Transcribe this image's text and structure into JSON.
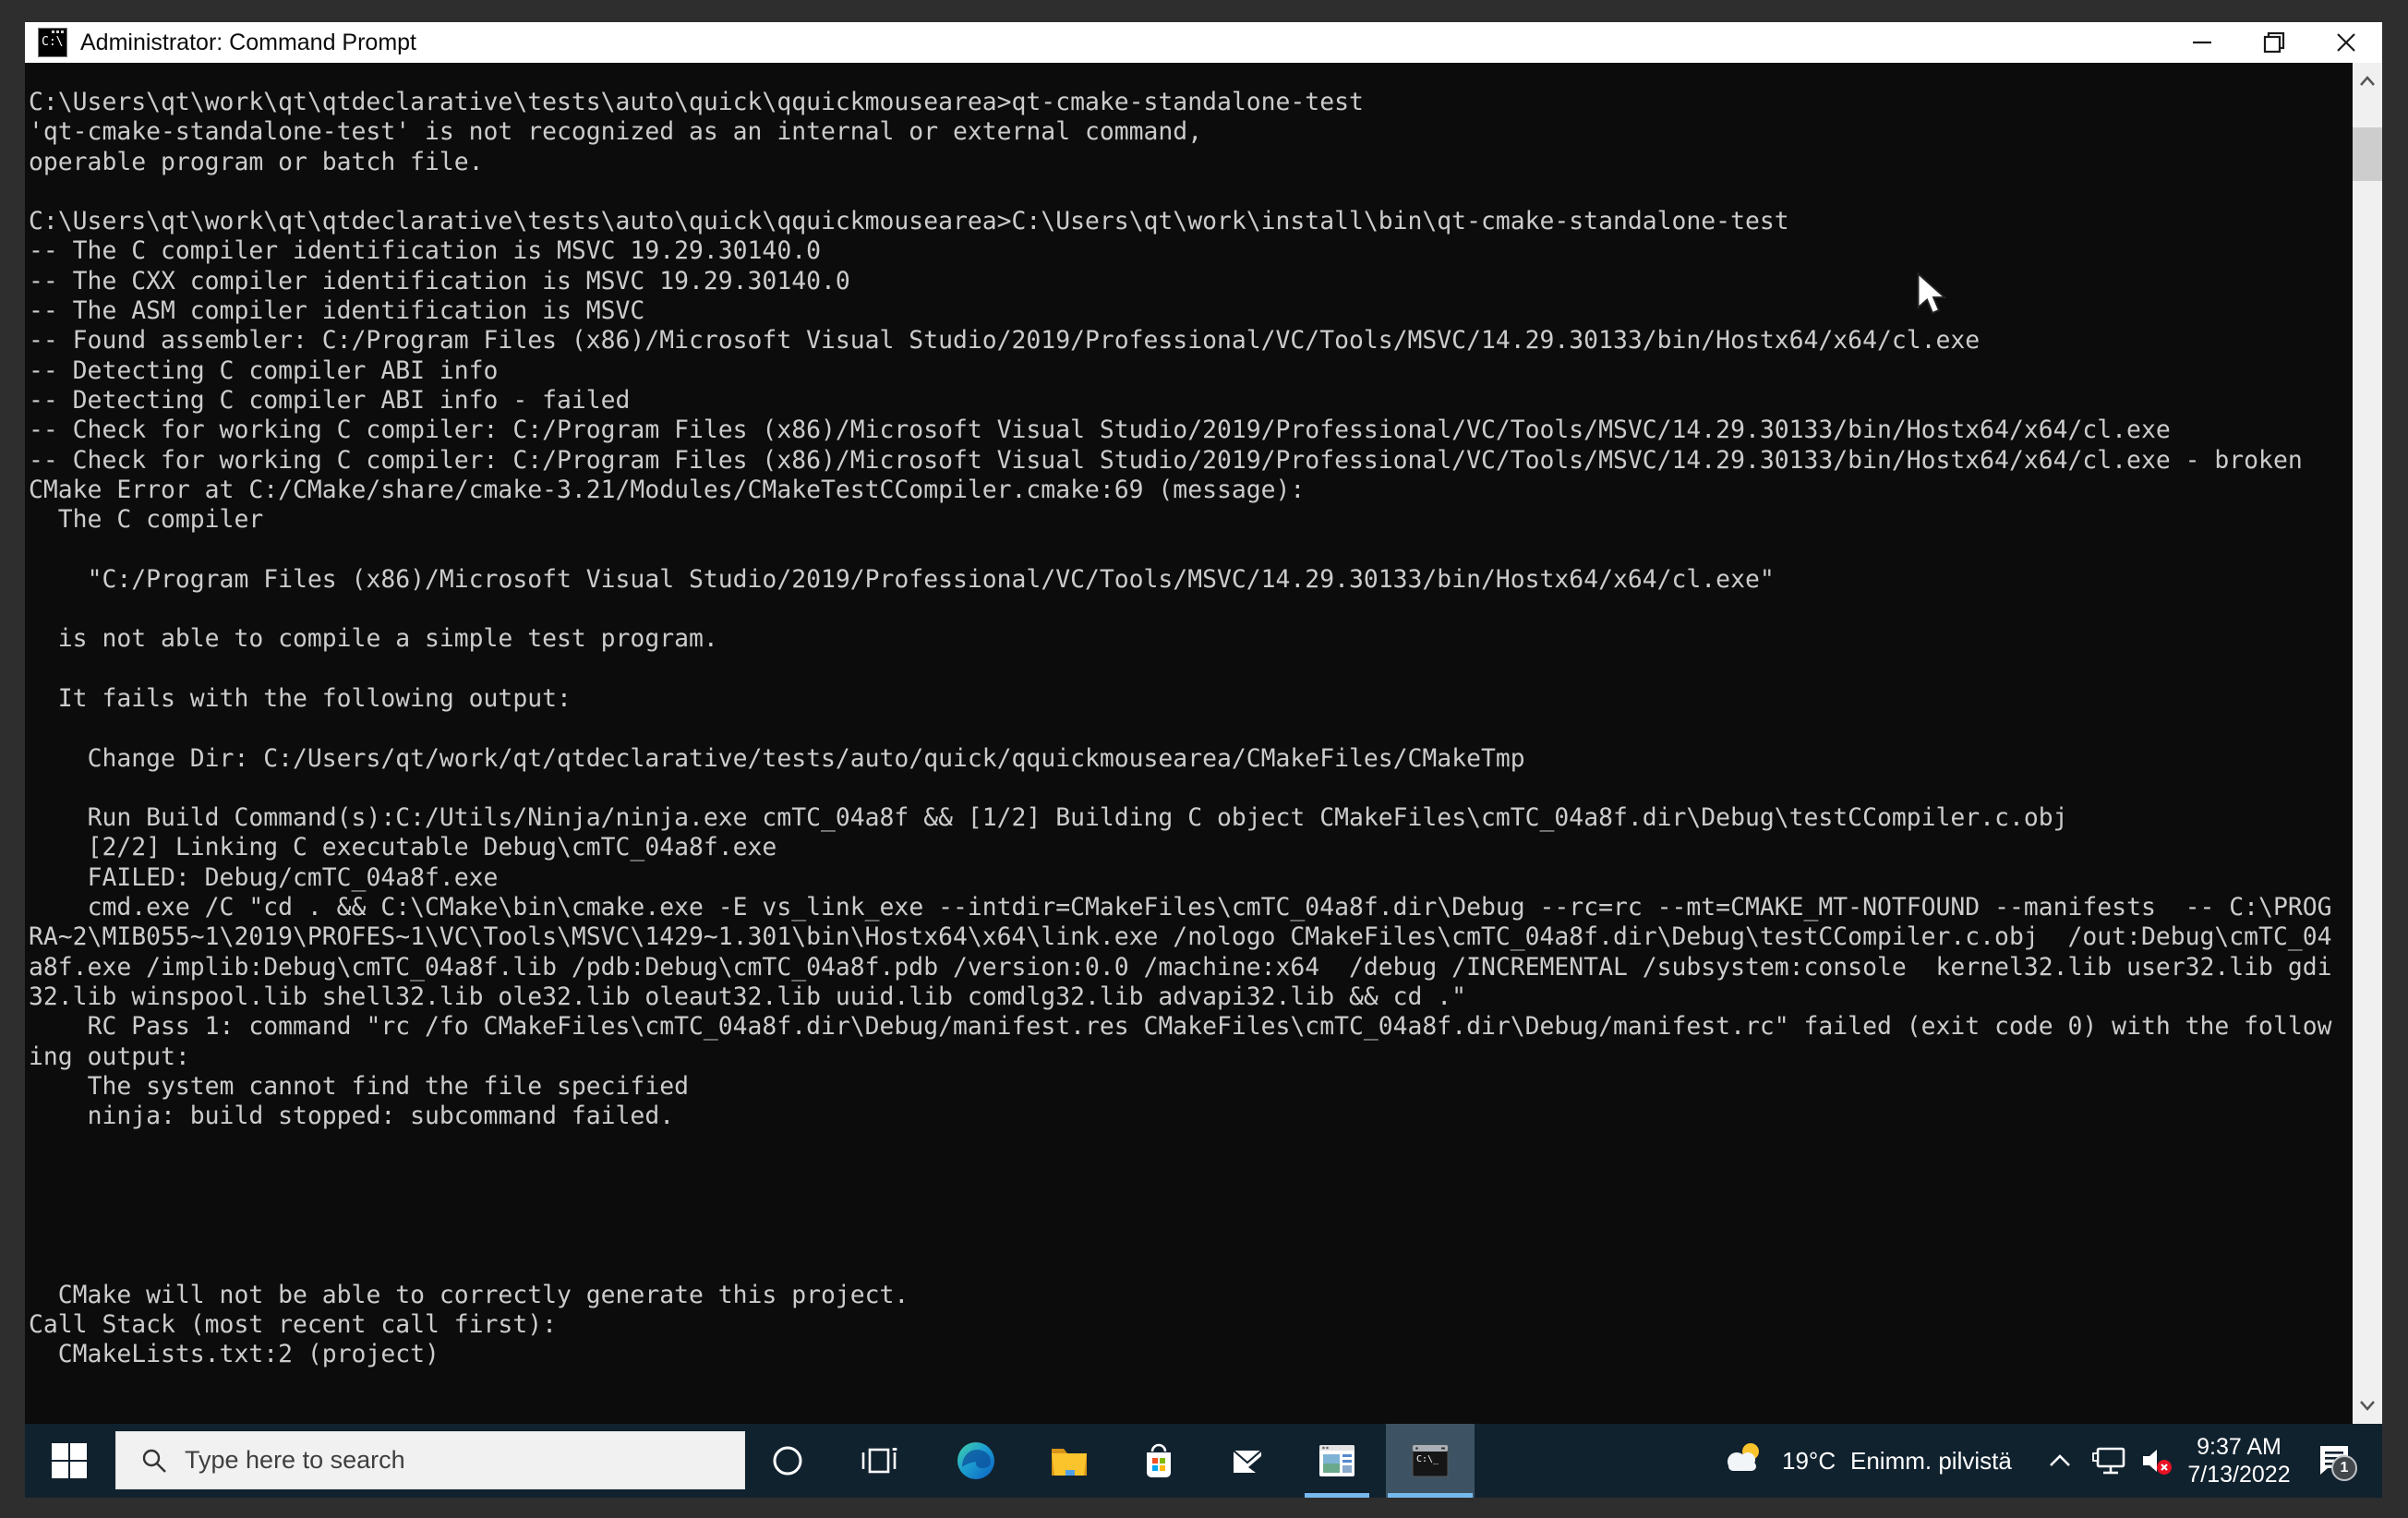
{
  "window": {
    "title": "Administrator: Command Prompt"
  },
  "console": {
    "lines": [
      "C:\\Users\\qt\\work\\qt\\qtdeclarative\\tests\\auto\\quick\\qquickmousearea>qt-cmake-standalone-test",
      "'qt-cmake-standalone-test' is not recognized as an internal or external command,",
      "operable program or batch file.",
      "",
      "C:\\Users\\qt\\work\\qt\\qtdeclarative\\tests\\auto\\quick\\qquickmousearea>C:\\Users\\qt\\work\\install\\bin\\qt-cmake-standalone-test",
      "-- The C compiler identification is MSVC 19.29.30140.0",
      "-- The CXX compiler identification is MSVC 19.29.30140.0",
      "-- The ASM compiler identification is MSVC",
      "-- Found assembler: C:/Program Files (x86)/Microsoft Visual Studio/2019/Professional/VC/Tools/MSVC/14.29.30133/bin/Hostx64/x64/cl.exe",
      "-- Detecting C compiler ABI info",
      "-- Detecting C compiler ABI info - failed",
      "-- Check for working C compiler: C:/Program Files (x86)/Microsoft Visual Studio/2019/Professional/VC/Tools/MSVC/14.29.30133/bin/Hostx64/x64/cl.exe",
      "-- Check for working C compiler: C:/Program Files (x86)/Microsoft Visual Studio/2019/Professional/VC/Tools/MSVC/14.29.30133/bin/Hostx64/x64/cl.exe - broken",
      "CMake Error at C:/CMake/share/cmake-3.21/Modules/CMakeTestCCompiler.cmake:69 (message):",
      "  The C compiler",
      "",
      "    \"C:/Program Files (x86)/Microsoft Visual Studio/2019/Professional/VC/Tools/MSVC/14.29.30133/bin/Hostx64/x64/cl.exe\"",
      "",
      "  is not able to compile a simple test program.",
      "",
      "  It fails with the following output:",
      "",
      "    Change Dir: C:/Users/qt/work/qt/qtdeclarative/tests/auto/quick/qquickmousearea/CMakeFiles/CMakeTmp",
      "",
      "    Run Build Command(s):C:/Utils/Ninja/ninja.exe cmTC_04a8f && [1/2] Building C object CMakeFiles\\cmTC_04a8f.dir\\Debug\\testCCompiler.c.obj",
      "    [2/2] Linking C executable Debug\\cmTC_04a8f.exe",
      "    FAILED: Debug/cmTC_04a8f.exe",
      "    cmd.exe /C \"cd . && C:\\CMake\\bin\\cmake.exe -E vs_link_exe --intdir=CMakeFiles\\cmTC_04a8f.dir\\Debug --rc=rc --mt=CMAKE_MT-NOTFOUND --manifests  -- C:\\PROG",
      "RA~2\\MIB055~1\\2019\\PROFES~1\\VC\\Tools\\MSVC\\1429~1.301\\bin\\Hostx64\\x64\\link.exe /nologo CMakeFiles\\cmTC_04a8f.dir\\Debug\\testCCompiler.c.obj  /out:Debug\\cmTC_04",
      "a8f.exe /implib:Debug\\cmTC_04a8f.lib /pdb:Debug\\cmTC_04a8f.pdb /version:0.0 /machine:x64  /debug /INCREMENTAL /subsystem:console  kernel32.lib user32.lib gdi",
      "32.lib winspool.lib shell32.lib ole32.lib oleaut32.lib uuid.lib comdlg32.lib advapi32.lib && cd .\"",
      "    RC Pass 1: command \"rc /fo CMakeFiles\\cmTC_04a8f.dir\\Debug/manifest.res CMakeFiles\\cmTC_04a8f.dir\\Debug/manifest.rc\" failed (exit code 0) with the follow",
      "ing output:",
      "    The system cannot find the file specified",
      "    ninja: build stopped: subcommand failed.",
      "",
      "",
      "",
      "",
      "",
      "  CMake will not be able to correctly generate this project.",
      "Call Stack (most recent call first):",
      "  CMakeLists.txt:2 (project)"
    ]
  },
  "taskbar": {
    "search": {
      "placeholder": "Type here to search"
    },
    "tray": {
      "temperature": "19°C",
      "condition": "Enimm. pilvistä",
      "time": "9:37 AM",
      "date": "7/13/2022",
      "notification_count": "1"
    }
  },
  "icons": {
    "titlebar": [
      "cmd-window-icon",
      "minimize-icon",
      "restore-icon",
      "close-icon"
    ],
    "taskbar": [
      "windows-start-icon",
      "search-icon",
      "cortana-icon",
      "task-view-icon",
      "edge-icon",
      "file-explorer-icon",
      "store-icon",
      "mail-icon",
      "app-window-icon",
      "command-prompt-icon"
    ],
    "tray": [
      "weather-icon",
      "chevron-up-icon",
      "network-icon",
      "volume-muted-icon",
      "action-center-icon"
    ]
  },
  "colors": {
    "console_bg": "#0c0c0c",
    "console_fg": "#cccccc",
    "titlebar_bg": "#ffffff",
    "taskbar_bg": "#11222f",
    "accent_underline": "#76b9ed",
    "mute_badge": "#e81123",
    "frame": "#2e2e2e"
  }
}
